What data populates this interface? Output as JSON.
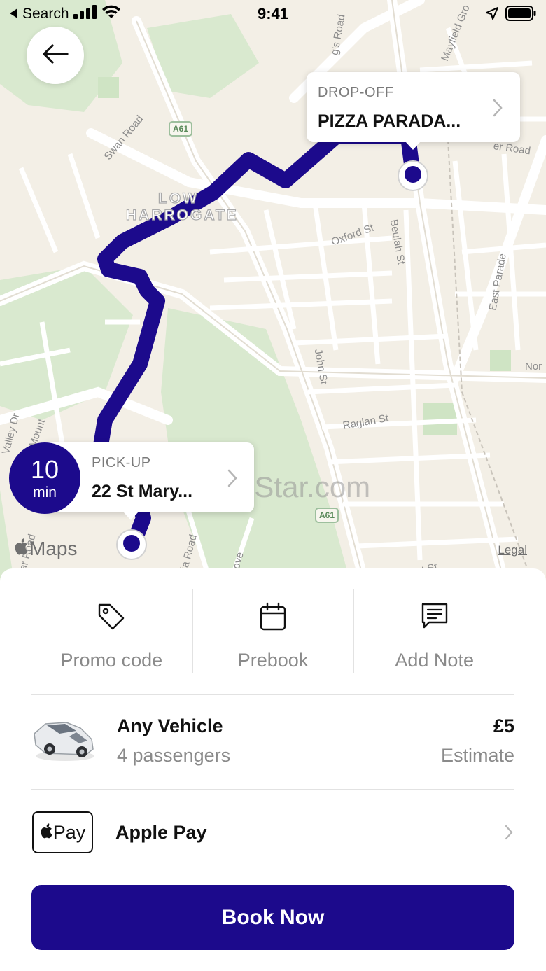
{
  "status_bar": {
    "back_app_label": "Search",
    "time": "9:41"
  },
  "map": {
    "district_line1": "LOW",
    "district_line2": "HARROGATE",
    "road_shield": "A61",
    "roads": {
      "kings_road": "g's Road",
      "mayfield": "Mayfield Gro",
      "swan_road": "Swan Road",
      "oxford": "Oxford St",
      "beulah": "Beulah St",
      "east_parade": "East Parade",
      "john": "John St",
      "raglan": "Raglan St",
      "valley": "Valley Dr",
      "mount": "Mount",
      "bar_road": "Bar Road",
      "ria_road": "ria Road",
      "grove": "Grove",
      "nor": "Nor",
      "er_road": "er Road",
      "rt_st": "rt St"
    },
    "maps_brand": "Maps",
    "legal": "Legal",
    "watermark": "UpdateStar.com",
    "route_color": "#1c0a8c"
  },
  "dropoff": {
    "caption": "DROP-OFF",
    "address": "PIZZA PARADA..."
  },
  "pickup": {
    "caption": "PICK-UP",
    "address": "22 St Mary...",
    "eta_value": "10",
    "eta_unit": "min"
  },
  "options": {
    "promo": "Promo code",
    "prebook": "Prebook",
    "note": "Add Note"
  },
  "vehicle": {
    "name": "Any Vehicle",
    "passengers": "4 passengers",
    "price": "£5",
    "price_note": "Estimate"
  },
  "payment": {
    "badge_text": "Pay",
    "method": "Apple Pay"
  },
  "book_button": "Book Now",
  "colors": {
    "accent": "#1c0a8c",
    "map_bg": "#f3efe6",
    "park": "#d9e9cf"
  }
}
